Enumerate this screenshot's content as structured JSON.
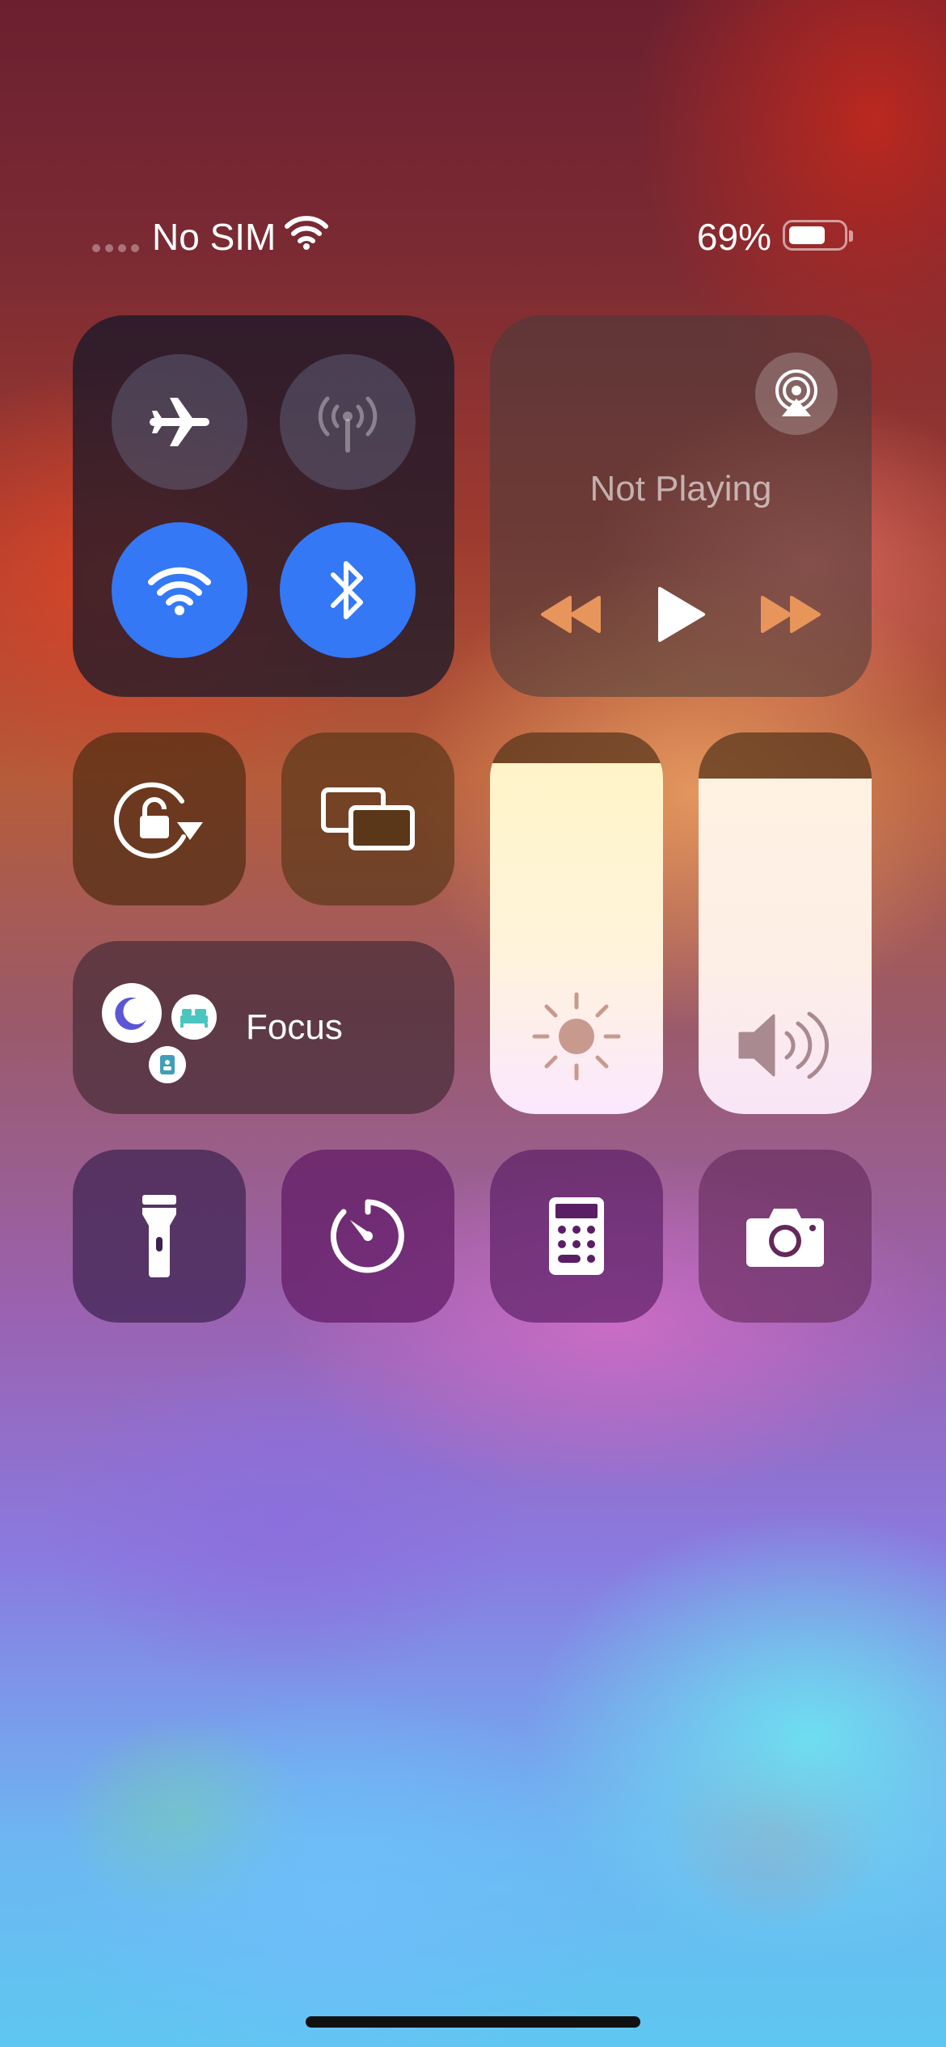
{
  "status_bar": {
    "carrier": "No SIM",
    "battery_percent": "69%",
    "battery_level": 0.69
  },
  "connectivity": {
    "airplane_mode": {
      "icon": "airplane-icon",
      "on": false
    },
    "cellular_data": {
      "icon": "antenna-icon",
      "on": false
    },
    "wifi": {
      "icon": "wifi-icon",
      "on": true
    },
    "bluetooth": {
      "icon": "bluetooth-icon",
      "on": true
    },
    "active_color": "#3478f6"
  },
  "now_playing": {
    "title": "Not Playing",
    "airplay_icon": "airplay-audio-icon",
    "controls": [
      "rewind-icon",
      "play-icon",
      "fast-forward-icon"
    ],
    "control_accent": "#e8955c"
  },
  "toggles": {
    "orientation_lock": {
      "icon": "rotation-lock-icon"
    },
    "screen_mirroring": {
      "icon": "screen-mirroring-icon"
    }
  },
  "focus": {
    "label": "Focus",
    "modes": [
      "moon-icon",
      "bed-icon",
      "id-badge-icon"
    ]
  },
  "sliders": {
    "brightness": {
      "icon": "sun-icon",
      "level": 0.92
    },
    "volume": {
      "icon": "speaker-icon",
      "level": 0.88
    }
  },
  "shortcuts": [
    {
      "name": "flashlight",
      "icon": "flashlight-icon"
    },
    {
      "name": "timer",
      "icon": "timer-icon"
    },
    {
      "name": "calculator",
      "icon": "calculator-icon"
    },
    {
      "name": "camera",
      "icon": "camera-icon"
    }
  ]
}
